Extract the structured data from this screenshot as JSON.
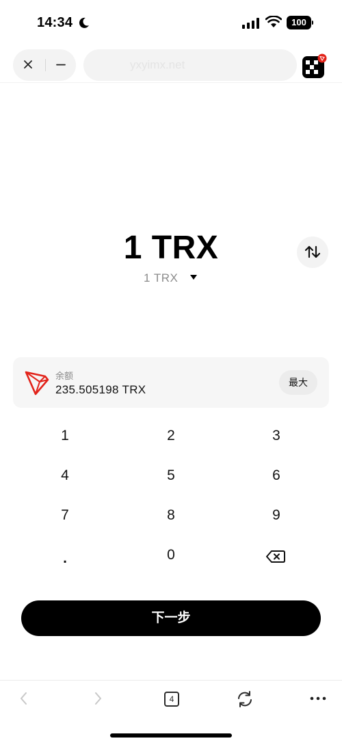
{
  "status_bar": {
    "time": "14:34",
    "battery": "100"
  },
  "browser": {
    "url": "yxyimx.net",
    "close_icon": "close-icon",
    "minimize_icon": "minimize-icon",
    "app_logo": "okx-logo"
  },
  "amount": {
    "main": "1 TRX",
    "sub": "1  TRX"
  },
  "balance": {
    "label": "余额",
    "value": "235.505198  TRX",
    "max_label": "最大",
    "token_icon": "tron-icon"
  },
  "keypad": {
    "keys": [
      "1",
      "2",
      "3",
      "4",
      "5",
      "6",
      "7",
      "8",
      "9",
      ".",
      "0"
    ],
    "backspace_icon": "backspace-icon"
  },
  "next_label": "下一步",
  "toolbar": {
    "tab_count": "4",
    "icons": [
      "back-icon",
      "forward-icon",
      "tabs-icon",
      "refresh-icon",
      "more-icon"
    ]
  },
  "colors": {
    "tron_red": "#e2231a",
    "button_bg": "#000000",
    "card_bg": "#f6f6f6"
  }
}
